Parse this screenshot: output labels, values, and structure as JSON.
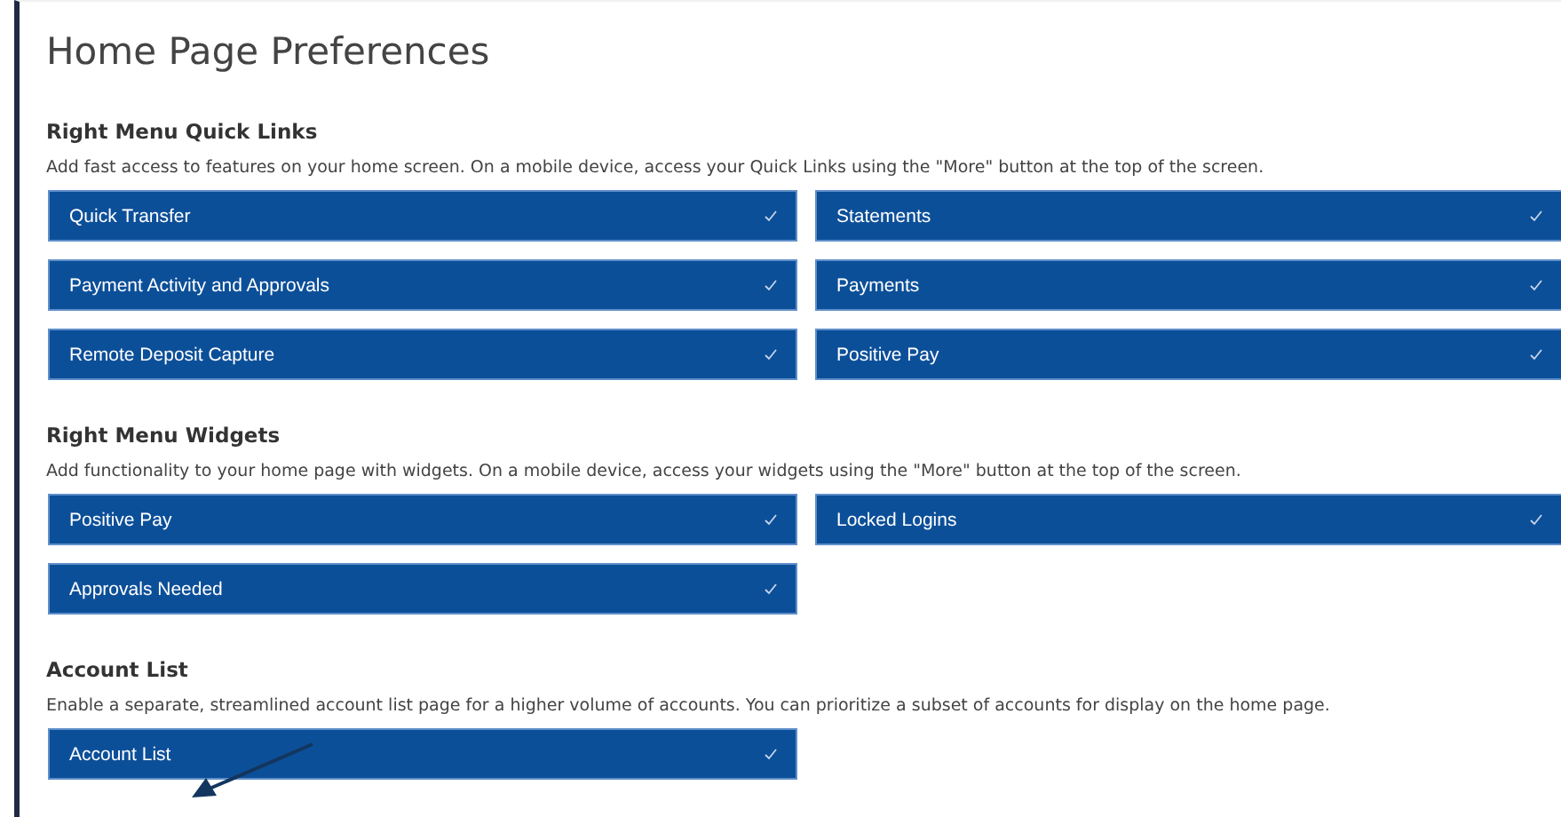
{
  "title": "Home Page Preferences",
  "sections": [
    {
      "heading": "Right Menu Quick Links",
      "description": "Add fast access to features on your home screen. On a mobile device, access your Quick Links using the \"More\" button at the top of the screen.",
      "items": [
        {
          "label": "Quick Transfer",
          "checked": true
        },
        {
          "label": "Statements",
          "checked": true
        },
        {
          "label": "Payment Activity and Approvals",
          "checked": true
        },
        {
          "label": "Payments",
          "checked": true
        },
        {
          "label": "Remote Deposit Capture",
          "checked": true
        },
        {
          "label": "Positive Pay",
          "checked": true
        }
      ]
    },
    {
      "heading": "Right Menu Widgets",
      "description": "Add functionality to your home page with widgets. On a mobile device, access your widgets using the \"More\" button at the top of the screen.",
      "items": [
        {
          "label": "Positive Pay",
          "checked": true
        },
        {
          "label": "Locked Logins",
          "checked": true
        },
        {
          "label": "Approvals Needed",
          "checked": true
        }
      ]
    },
    {
      "heading": "Account List",
      "description": "Enable a separate, streamlined account list page for a higher volume of accounts. You can prioritize a subset of accounts for display on the home page.",
      "items": [
        {
          "label": "Account List",
          "checked": true
        }
      ]
    }
  ]
}
